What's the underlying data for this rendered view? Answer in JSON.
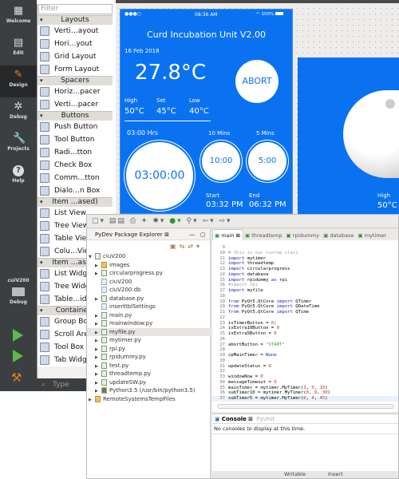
{
  "modebar": {
    "items": [
      {
        "label": "Welcome",
        "icon": "grid-icon"
      },
      {
        "label": "Edit",
        "icon": "document-icon"
      },
      {
        "label": "Design",
        "icon": "pencil-icon",
        "active": true
      },
      {
        "label": "Debug",
        "icon": "bug-icon"
      },
      {
        "label": "Projects",
        "icon": "wrench-icon"
      },
      {
        "label": "Help",
        "icon": "help-icon"
      }
    ],
    "kit": {
      "project": "cuiV200",
      "mode": "Debug"
    }
  },
  "widgetbox": {
    "filter_placeholder": "Filter",
    "groups": [
      {
        "title": "Layouts",
        "items": [
          "Verti…ayout",
          "Hori…yout",
          "Grid Layout",
          "Form Layout"
        ]
      },
      {
        "title": "Spacers",
        "items": [
          "Horiz…pacer",
          "Verti…pacer"
        ]
      },
      {
        "title": "Buttons",
        "items": [
          "Push Button",
          "Tool Button",
          "Radi…tton",
          "Check Box",
          "Comm…tton",
          "Dialo…n Box"
        ]
      },
      {
        "title": "Item …ased)",
        "items": [
          "List View",
          "Tree View",
          "Table View",
          "Colu…View"
        ]
      },
      {
        "title": "Item …ased)",
        "items": [
          "List Widget",
          "Tree Widget",
          "Table…idget"
        ]
      },
      {
        "title": "Containers",
        "items": [
          "Group Box",
          "Scroll Area",
          "Tool Box",
          "Tab Widget"
        ]
      }
    ],
    "search_placeholder": "Type"
  },
  "phone": {
    "status_time": "08:36 AM",
    "battery": "100%",
    "title": "Curd Incubation Unit V2.00",
    "date": "16 Feb 2018",
    "temperature": "27.8°C",
    "abort_label": "ABORT",
    "high_label": "High",
    "high_value": "50°C",
    "set_label": "Set",
    "set_value": "45°C",
    "low_label": "Low",
    "low_value": "40°C",
    "main_timer_label": "03:00 Hrs",
    "main_timer": "03:00:00",
    "timer10_label": "10 Mins",
    "timer10": "10:00",
    "timer5_label": "5 Mins",
    "timer5": "5:00",
    "start_label": "Start",
    "start_time": "03:32 PM",
    "end_label": "End",
    "end_time": "06:32 PM",
    "accent": "#0a72f0"
  },
  "panel2": {
    "high_label": "High",
    "high_value": "50°C"
  },
  "eclipse": {
    "explorer": {
      "title": "PyDev Package Explorer",
      "project": "ciuV200",
      "items": [
        {
          "name": "images",
          "type": "folder",
          "expandable": true
        },
        {
          "name": "circularprogress.py",
          "type": "py",
          "expandable": true
        },
        {
          "name": "ciuV200",
          "type": "file",
          "expandable": false
        },
        {
          "name": "ciuV200.db",
          "type": "file",
          "expandable": false
        },
        {
          "name": "database.py",
          "type": "py",
          "expandable": true
        },
        {
          "name": "inserttblSettings",
          "type": "file",
          "expandable": false
        },
        {
          "name": "main.py",
          "type": "py",
          "expandable": true
        },
        {
          "name": "mainwindow.py",
          "type": "py",
          "expandable": true
        },
        {
          "name": "myfile.py",
          "type": "py",
          "expandable": true,
          "selected": true
        },
        {
          "name": "mytimer.py",
          "type": "py",
          "expandable": true
        },
        {
          "name": "rpi.py",
          "type": "py",
          "expandable": true
        },
        {
          "name": "rpidummy.py",
          "type": "py",
          "expandable": true
        },
        {
          "name": "test.py",
          "type": "py",
          "expandable": true
        },
        {
          "name": "threadtemp.py",
          "type": "py",
          "expandable": true
        },
        {
          "name": "updateSW.py",
          "type": "py",
          "expandable": true
        },
        {
          "name": "Python3.5  (/usr/bin/python3.5)",
          "type": "python",
          "expandable": true
        }
      ],
      "other_project": "RemoteSystemsTempFiles"
    },
    "tabs": [
      "main",
      "threadtemp",
      "rpidummy",
      "database",
      "mytimer"
    ],
    "code": [
      {
        "n": "9",
        "seg": []
      },
      {
        "n": "10",
        "seg": [
          [
            "# This is our custom class",
            "cm"
          ]
        ]
      },
      {
        "n": "11",
        "seg": [
          [
            "import",
            "kw"
          ],
          [
            " mytimer",
            ""
          ]
        ]
      },
      {
        "n": "12",
        "seg": [
          [
            "import",
            "kw"
          ],
          [
            " threadtemp",
            ""
          ]
        ]
      },
      {
        "n": "13",
        "seg": [
          [
            "import",
            "kw"
          ],
          [
            " circularprogress",
            ""
          ]
        ]
      },
      {
        "n": "14",
        "seg": [
          [
            "import",
            "kw"
          ],
          [
            " database",
            ""
          ]
        ]
      },
      {
        "n": "15",
        "seg": [
          [
            "import",
            "kw"
          ],
          [
            " rpidummy ",
            ""
          ],
          [
            "as",
            "kw"
          ],
          [
            " rpi",
            ""
          ]
        ]
      },
      {
        "n": "16",
        "seg": [
          [
            "#import rpi",
            "cm"
          ]
        ]
      },
      {
        "n": "17",
        "seg": [
          [
            "import",
            "kw"
          ],
          [
            " myfile",
            ""
          ]
        ]
      },
      {
        "n": "18",
        "seg": []
      },
      {
        "n": "19",
        "seg": [
          [
            "from",
            "kw"
          ],
          [
            " PyQt5.QtCore ",
            ""
          ],
          [
            "import",
            "kw"
          ],
          [
            " QTimer",
            ""
          ]
        ]
      },
      {
        "n": "20",
        "seg": [
          [
            "from",
            "kw"
          ],
          [
            " PyQt5.QtCore ",
            ""
          ],
          [
            "import",
            "kw"
          ],
          [
            " QDateTime",
            ""
          ]
        ]
      },
      {
        "n": "21",
        "seg": [
          [
            "from",
            "kw"
          ],
          [
            " PyQt5.QtCore ",
            ""
          ],
          [
            "import",
            "kw"
          ],
          [
            " QTime",
            ""
          ]
        ]
      },
      {
        "n": "22",
        "seg": []
      },
      {
        "n": "23",
        "seg": [
          [
            "isTimerButton = ",
            ""
          ],
          [
            "0",
            "nm"
          ],
          [
            ";",
            ""
          ]
        ]
      },
      {
        "n": "24",
        "seg": [
          [
            "isExtra10Button = ",
            ""
          ],
          [
            "0",
            "nm"
          ]
        ]
      },
      {
        "n": "25",
        "seg": [
          [
            "isExtra5Button = ",
            ""
          ],
          [
            "0",
            "nm"
          ]
        ]
      },
      {
        "n": "26",
        "seg": []
      },
      {
        "n": "27",
        "seg": [
          [
            "abortButton = ",
            ""
          ],
          [
            "\"START\"",
            "st"
          ]
        ]
      },
      {
        "n": "28",
        "seg": []
      },
      {
        "n": "29",
        "seg": [
          [
            "cpMainTimer = ",
            ""
          ],
          [
            "None",
            "no2"
          ]
        ]
      },
      {
        "n": "30",
        "seg": []
      },
      {
        "n": "31",
        "seg": [
          [
            "updateStatus = ",
            ""
          ],
          [
            "0",
            "nm"
          ]
        ]
      },
      {
        "n": "32",
        "seg": []
      },
      {
        "n": "33",
        "seg": [
          [
            "windowNow = ",
            ""
          ],
          [
            "0",
            "nm"
          ]
        ]
      },
      {
        "n": "34",
        "seg": [
          [
            "messageTimeout = ",
            ""
          ],
          [
            "0",
            "nm"
          ]
        ]
      },
      {
        "n": "35",
        "seg": [
          [
            "mainTimer = mytimer.MyTimer(",
            ""
          ],
          [
            "3",
            "nm"
          ],
          [
            ", ",
            ""
          ],
          [
            "5",
            "nm"
          ],
          [
            ", ",
            ""
          ],
          [
            "10",
            "nm"
          ],
          [
            ")",
            ""
          ]
        ]
      },
      {
        "n": "36",
        "seg": [
          [
            "subTimer10 = mytimer.MyTimer(",
            ""
          ],
          [
            "0",
            "nm"
          ],
          [
            ", ",
            ""
          ],
          [
            "9",
            "nm"
          ],
          [
            ", ",
            ""
          ],
          [
            "30",
            "nm"
          ],
          [
            ")",
            ""
          ]
        ]
      },
      {
        "n": "37",
        "seg": [
          [
            "subTimer5 = mytimer.MyTimer(",
            ""
          ],
          [
            "0",
            "nm"
          ],
          [
            ", ",
            ""
          ],
          [
            "4",
            "nm"
          ],
          [
            ", ",
            ""
          ],
          [
            "45",
            "nm"
          ],
          [
            ")",
            ""
          ]
        ],
        "current": true
      }
    ],
    "console": {
      "tab": "Console",
      "tab2": "PyUnit",
      "message": "No consoles to display at this time."
    },
    "status": {
      "writable": "Writable",
      "mode": "Insert"
    }
  }
}
